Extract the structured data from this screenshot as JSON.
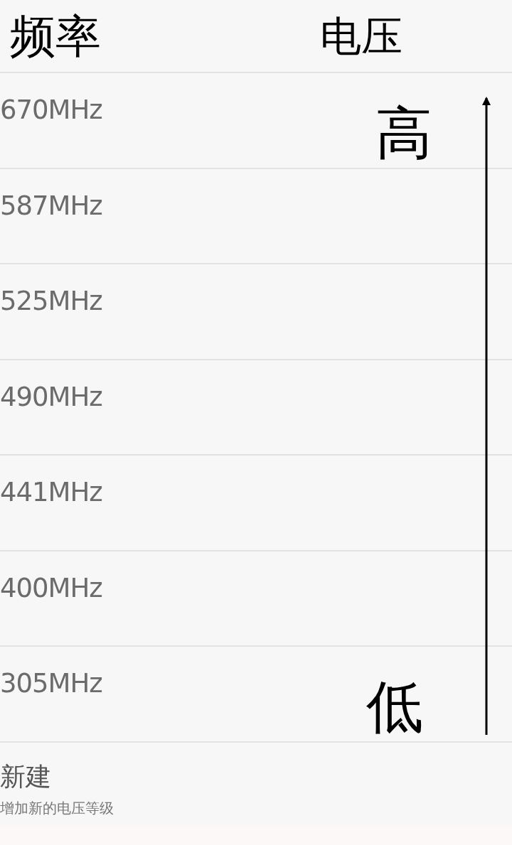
{
  "header": {
    "columns": [
      "频率",
      "电压"
    ]
  },
  "annotation": {
    "high_label": "高",
    "low_label": "低"
  },
  "rows": [
    {
      "frequency": "670MHz"
    },
    {
      "frequency": "587MHz"
    },
    {
      "frequency": "525MHz"
    },
    {
      "frequency": "490MHz"
    },
    {
      "frequency": "441MHz"
    },
    {
      "frequency": "400MHz"
    },
    {
      "frequency": "305MHz"
    }
  ],
  "new_item": {
    "title": "新建",
    "subtitle": "增加新的电压等级"
  }
}
